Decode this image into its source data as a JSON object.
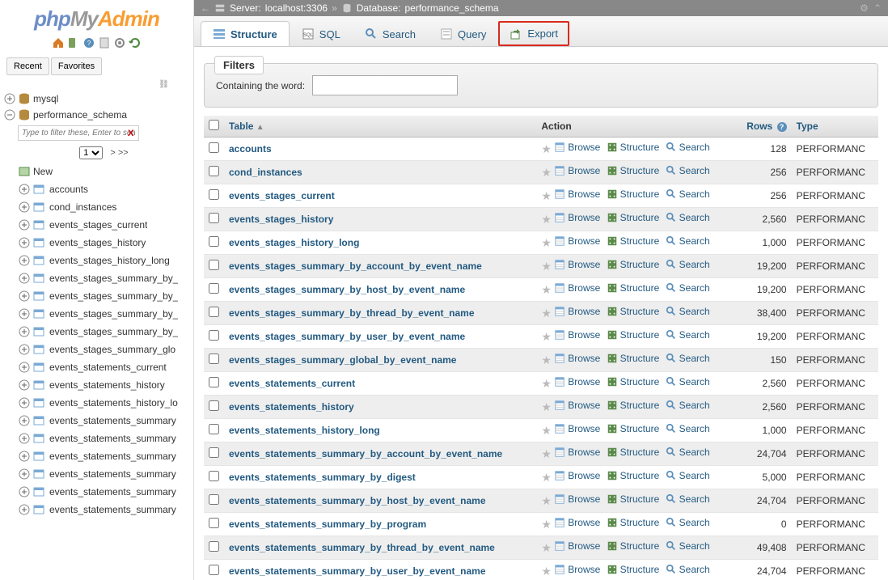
{
  "logo": {
    "php": "php",
    "my": "My",
    "admin": "Admin"
  },
  "sidebar": {
    "recent": "Recent",
    "favorites": "Favorites",
    "filter_placeholder": "Type to filter these, Enter to searc",
    "page_value": "1",
    "page_next": "> >>",
    "new_label": "New",
    "db_mysql": "mysql",
    "db_perf": "performance_schema",
    "tables": [
      "accounts",
      "cond_instances",
      "events_stages_current",
      "events_stages_history",
      "events_stages_history_long",
      "events_stages_summary_by_",
      "events_stages_summary_by_",
      "events_stages_summary_by_",
      "events_stages_summary_by_",
      "events_stages_summary_glo",
      "events_statements_current",
      "events_statements_history",
      "events_statements_history_lo",
      "events_statements_summary",
      "events_statements_summary",
      "events_statements_summary",
      "events_statements_summary",
      "events_statements_summary",
      "events_statements_summary"
    ]
  },
  "topbar": {
    "server_label": "Server:",
    "server_value": "localhost:3306",
    "db_label": "Database:",
    "db_value": "performance_schema"
  },
  "tabs": {
    "structure": "Structure",
    "sql": "SQL",
    "search": "Search",
    "query": "Query",
    "export": "Export"
  },
  "filters": {
    "legend": "Filters",
    "containing": "Containing the word:"
  },
  "columns": {
    "table": "Table",
    "action": "Action",
    "rows": "Rows",
    "type": "Type"
  },
  "actions": {
    "browse": "Browse",
    "structure": "Structure",
    "search": "Search"
  },
  "type_value": "PERFORMANC",
  "rows": [
    {
      "name": "accounts",
      "rows": "128"
    },
    {
      "name": "cond_instances",
      "rows": "256"
    },
    {
      "name": "events_stages_current",
      "rows": "256"
    },
    {
      "name": "events_stages_history",
      "rows": "2,560"
    },
    {
      "name": "events_stages_history_long",
      "rows": "1,000"
    },
    {
      "name": "events_stages_summary_by_account_by_event_name",
      "rows": "19,200"
    },
    {
      "name": "events_stages_summary_by_host_by_event_name",
      "rows": "19,200"
    },
    {
      "name": "events_stages_summary_by_thread_by_event_name",
      "rows": "38,400"
    },
    {
      "name": "events_stages_summary_by_user_by_event_name",
      "rows": "19,200"
    },
    {
      "name": "events_stages_summary_global_by_event_name",
      "rows": "150"
    },
    {
      "name": "events_statements_current",
      "rows": "2,560"
    },
    {
      "name": "events_statements_history",
      "rows": "2,560"
    },
    {
      "name": "events_statements_history_long",
      "rows": "1,000"
    },
    {
      "name": "events_statements_summary_by_account_by_event_name",
      "rows": "24,704"
    },
    {
      "name": "events_statements_summary_by_digest",
      "rows": "5,000"
    },
    {
      "name": "events_statements_summary_by_host_by_event_name",
      "rows": "24,704"
    },
    {
      "name": "events_statements_summary_by_program",
      "rows": "0"
    },
    {
      "name": "events_statements_summary_by_thread_by_event_name",
      "rows": "49,408"
    },
    {
      "name": "events_statements_summary_by_user_by_event_name",
      "rows": "24,704"
    }
  ]
}
